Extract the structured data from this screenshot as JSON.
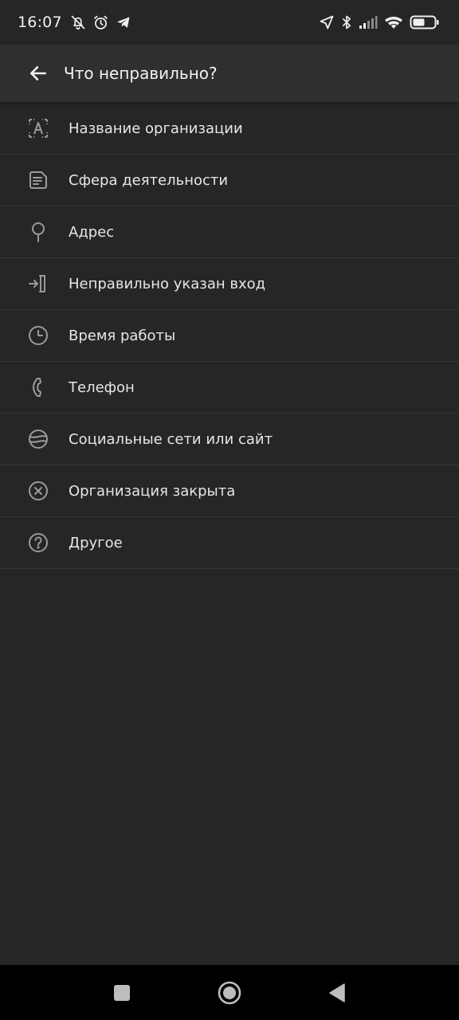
{
  "status_bar": {
    "time": "16:07",
    "left_icons": [
      "bell-off-icon",
      "alarm-icon",
      "telegram-icon"
    ],
    "right_icons": [
      "location-arrow-icon",
      "bluetooth-icon",
      "signal-icon",
      "wifi-icon",
      "battery-icon"
    ]
  },
  "header": {
    "title": "Что неправильно?",
    "back_icon": "arrow-left-icon"
  },
  "menu": {
    "items": [
      {
        "label": "Название организации",
        "icon": "text-frame-icon"
      },
      {
        "label": "Сфера деятельности",
        "icon": "document-icon"
      },
      {
        "label": "Адрес",
        "icon": "map-pin-icon"
      },
      {
        "label": "Неправильно указан вход",
        "icon": "entrance-icon"
      },
      {
        "label": "Время работы",
        "icon": "clock-icon"
      },
      {
        "label": "Телефон",
        "icon": "phone-icon"
      },
      {
        "label": "Социальные сети или сайт",
        "icon": "globe-icon"
      },
      {
        "label": "Организация закрыта",
        "icon": "close-circle-icon"
      },
      {
        "label": "Другое",
        "icon": "question-circle-icon"
      }
    ]
  },
  "nav_bar": {
    "buttons": [
      "recents-square-icon",
      "home-circle-icon",
      "back-triangle-icon"
    ]
  },
  "colors": {
    "background": "#262626",
    "app_bar": "#2f2f2f",
    "divider": "#363636",
    "icon": "#9a9a9a",
    "text": "#e6e6e6",
    "nav_bar": "#000000"
  }
}
